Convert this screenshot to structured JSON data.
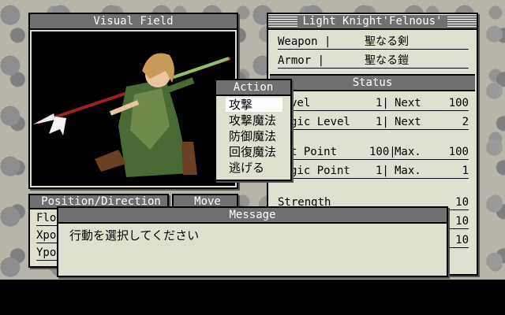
{
  "visual_field": {
    "title": "Visual Field"
  },
  "action_menu": {
    "title": "Action",
    "items": [
      "攻撃",
      "攻撃魔法",
      "防御魔法",
      "回復魔法",
      "逃げる"
    ],
    "selected_index": 0
  },
  "character": {
    "title": "Light Knight'Felnous'",
    "weapon_label": "Weapon |",
    "weapon_value": "聖なる剣",
    "armor_label": "Armor |",
    "armor_value": "聖なる鎧",
    "status_title": "Status",
    "level_label": "vel",
    "level_value": "1|",
    "level_next_label": "Next",
    "level_next_value": "100",
    "magic_level_label": "gic Level",
    "magic_level_value": "1|",
    "magic_level_next_label": "Next",
    "magic_level_next_value": "2",
    "hit_point_label": "t Point",
    "hit_point_value": "100|",
    "hit_point_max_label": "Max.",
    "hit_point_max_value": "100",
    "magic_point_label": "gic Point",
    "magic_point_value": "1|",
    "magic_point_max_label": "Max.",
    "magic_point_max_value": "1",
    "strength_label": "Strength",
    "strength_value": "10",
    "stat6_value": "10",
    "stat7_value": "10"
  },
  "position_panel": {
    "title": "Position/Direction",
    "rows": [
      "Flo",
      "Xpo",
      "Ypo"
    ]
  },
  "move_panel": {
    "title": "Move"
  },
  "message": {
    "title": "Message",
    "text": "行動を選択してください"
  },
  "colors": {
    "panel_bg": "#e0e0d0",
    "title_bg": "#707070",
    "title_fg": "#ffffff",
    "background": "#b7b5aa"
  }
}
